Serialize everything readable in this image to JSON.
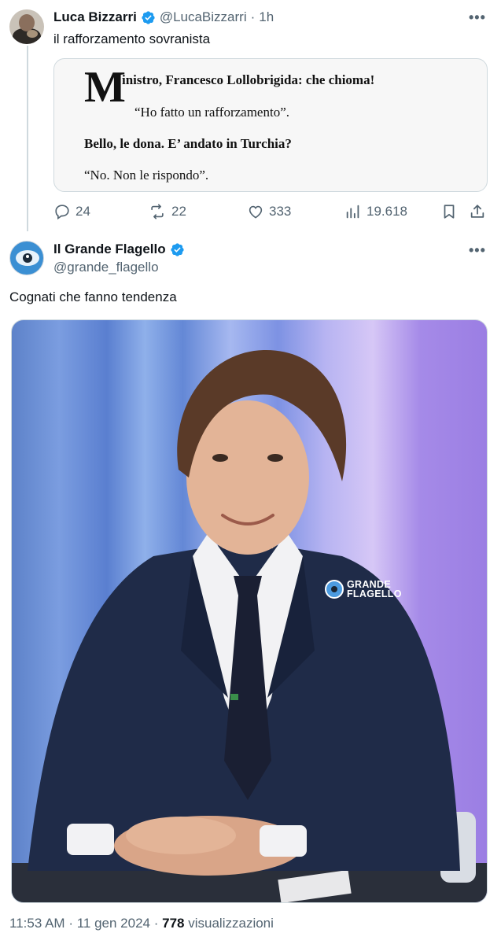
{
  "tweet1": {
    "author_name": "Luca Bizzarri",
    "handle": "@LucaBizzarri",
    "separator": "·",
    "time": "1h",
    "text": "il rafforzamento sovranista",
    "quote": {
      "dropcap": "M",
      "line1": "inistro, Francesco Lollobrigida: che chioma!",
      "line2": "“Ho fatto un rafforzamento”.",
      "line3": "Bello, le dona. E’ andato in Turchia?",
      "line4": "“No. Non le rispondo”."
    },
    "actions": {
      "replies": "24",
      "reposts": "22",
      "likes": "333",
      "views": "19.618"
    }
  },
  "tweet2": {
    "author_name": "Il Grande Flagello",
    "handle": "@grande_flagello",
    "text": "Cognati che fanno tendenza",
    "watermark_line1": "GRANDE",
    "watermark_line2": "FLAGELLO",
    "footer": {
      "time": "11:53 AM",
      "separator": "·",
      "date": "11 gen 2024",
      "separator2": "·",
      "views_count": "778",
      "views_label": "visualizzazioni"
    }
  },
  "colors": {
    "verified": "#1d9bf0",
    "secondary_text": "#536471",
    "primary_text": "#0f1419",
    "border": "#cfd9de"
  },
  "icons": [
    "verified-badge-icon",
    "more-icon",
    "reply-icon",
    "repost-icon",
    "like-icon",
    "views-icon",
    "bookmark-icon",
    "share-icon"
  ]
}
